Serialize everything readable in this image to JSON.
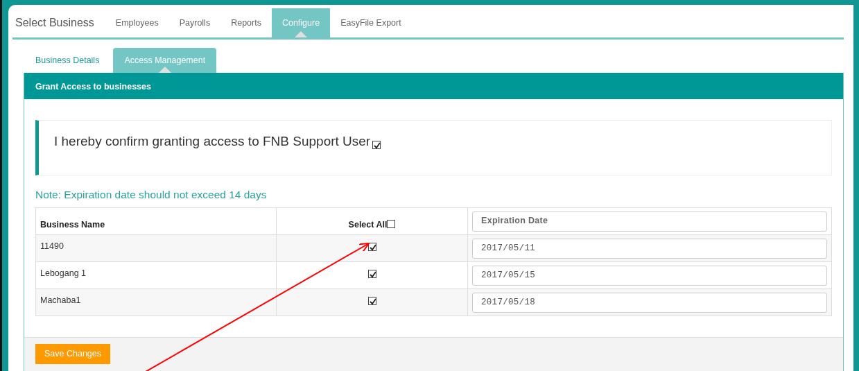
{
  "nav": {
    "title": "Select Business",
    "tabs": [
      {
        "label": "Employees",
        "selected": false
      },
      {
        "label": "Payrolls",
        "selected": false
      },
      {
        "label": "Reports",
        "selected": false
      },
      {
        "label": "Configure",
        "selected": true
      },
      {
        "label": "EasyFile Export",
        "selected": false
      }
    ]
  },
  "subtabs": [
    {
      "label": "Business Details",
      "selected": false
    },
    {
      "label": "Access Management",
      "selected": true
    }
  ],
  "panel": {
    "title": "Grant Access to businesses",
    "confirmation": {
      "text": "I hereby confirm granting access to FNB Support User",
      "checked": true
    },
    "note": "Note: Expiration date should not exceed 14 days",
    "table": {
      "columns": [
        {
          "kind": "text",
          "label": "Business Name"
        },
        {
          "kind": "select-all",
          "label": "Select All",
          "checked": false
        },
        {
          "kind": "field",
          "placeholder": "Expiration Date"
        }
      ],
      "rows": [
        {
          "name": "11490",
          "checked": true,
          "expiration": "2017/05/11"
        },
        {
          "name": "Lebogang 1",
          "checked": true,
          "expiration": "2017/05/15"
        },
        {
          "name": "Machaba1",
          "checked": true,
          "expiration": "2017/05/18"
        }
      ]
    },
    "save_button": "Save Changes"
  }
}
